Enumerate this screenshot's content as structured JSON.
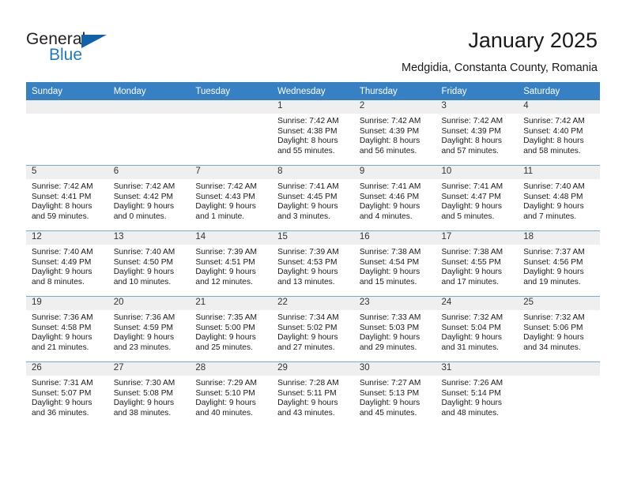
{
  "brand": {
    "name_part1": "General",
    "name_part2": "Blue"
  },
  "header": {
    "month_title": "January 2025",
    "location": "Medgidia, Constanta County, Romania"
  },
  "weekday_headers": [
    "Sunday",
    "Monday",
    "Tuesday",
    "Wednesday",
    "Thursday",
    "Friday",
    "Saturday"
  ],
  "colors": {
    "header_blue": "#3880c4",
    "brand_blue": "#1e7ac4",
    "logo_triangle_blue": "#1161ab",
    "daynum_bg": "#efefef",
    "grid_line": "#7ba7d0"
  },
  "weeks": [
    [
      {
        "empty": true
      },
      {
        "empty": true
      },
      {
        "empty": true
      },
      {
        "day": "1",
        "sunrise": "Sunrise: 7:42 AM",
        "sunset": "Sunset: 4:38 PM",
        "daylight1": "Daylight: 8 hours",
        "daylight2": "and 55 minutes."
      },
      {
        "day": "2",
        "sunrise": "Sunrise: 7:42 AM",
        "sunset": "Sunset: 4:39 PM",
        "daylight1": "Daylight: 8 hours",
        "daylight2": "and 56 minutes."
      },
      {
        "day": "3",
        "sunrise": "Sunrise: 7:42 AM",
        "sunset": "Sunset: 4:39 PM",
        "daylight1": "Daylight: 8 hours",
        "daylight2": "and 57 minutes."
      },
      {
        "day": "4",
        "sunrise": "Sunrise: 7:42 AM",
        "sunset": "Sunset: 4:40 PM",
        "daylight1": "Daylight: 8 hours",
        "daylight2": "and 58 minutes."
      }
    ],
    [
      {
        "day": "5",
        "sunrise": "Sunrise: 7:42 AM",
        "sunset": "Sunset: 4:41 PM",
        "daylight1": "Daylight: 8 hours",
        "daylight2": "and 59 minutes."
      },
      {
        "day": "6",
        "sunrise": "Sunrise: 7:42 AM",
        "sunset": "Sunset: 4:42 PM",
        "daylight1": "Daylight: 9 hours",
        "daylight2": "and 0 minutes."
      },
      {
        "day": "7",
        "sunrise": "Sunrise: 7:42 AM",
        "sunset": "Sunset: 4:43 PM",
        "daylight1": "Daylight: 9 hours",
        "daylight2": "and 1 minute."
      },
      {
        "day": "8",
        "sunrise": "Sunrise: 7:41 AM",
        "sunset": "Sunset: 4:45 PM",
        "daylight1": "Daylight: 9 hours",
        "daylight2": "and 3 minutes."
      },
      {
        "day": "9",
        "sunrise": "Sunrise: 7:41 AM",
        "sunset": "Sunset: 4:46 PM",
        "daylight1": "Daylight: 9 hours",
        "daylight2": "and 4 minutes."
      },
      {
        "day": "10",
        "sunrise": "Sunrise: 7:41 AM",
        "sunset": "Sunset: 4:47 PM",
        "daylight1": "Daylight: 9 hours",
        "daylight2": "and 5 minutes."
      },
      {
        "day": "11",
        "sunrise": "Sunrise: 7:40 AM",
        "sunset": "Sunset: 4:48 PM",
        "daylight1": "Daylight: 9 hours",
        "daylight2": "and 7 minutes."
      }
    ],
    [
      {
        "day": "12",
        "sunrise": "Sunrise: 7:40 AM",
        "sunset": "Sunset: 4:49 PM",
        "daylight1": "Daylight: 9 hours",
        "daylight2": "and 8 minutes."
      },
      {
        "day": "13",
        "sunrise": "Sunrise: 7:40 AM",
        "sunset": "Sunset: 4:50 PM",
        "daylight1": "Daylight: 9 hours",
        "daylight2": "and 10 minutes."
      },
      {
        "day": "14",
        "sunrise": "Sunrise: 7:39 AM",
        "sunset": "Sunset: 4:51 PM",
        "daylight1": "Daylight: 9 hours",
        "daylight2": "and 12 minutes."
      },
      {
        "day": "15",
        "sunrise": "Sunrise: 7:39 AM",
        "sunset": "Sunset: 4:53 PM",
        "daylight1": "Daylight: 9 hours",
        "daylight2": "and 13 minutes."
      },
      {
        "day": "16",
        "sunrise": "Sunrise: 7:38 AM",
        "sunset": "Sunset: 4:54 PM",
        "daylight1": "Daylight: 9 hours",
        "daylight2": "and 15 minutes."
      },
      {
        "day": "17",
        "sunrise": "Sunrise: 7:38 AM",
        "sunset": "Sunset: 4:55 PM",
        "daylight1": "Daylight: 9 hours",
        "daylight2": "and 17 minutes."
      },
      {
        "day": "18",
        "sunrise": "Sunrise: 7:37 AM",
        "sunset": "Sunset: 4:56 PM",
        "daylight1": "Daylight: 9 hours",
        "daylight2": "and 19 minutes."
      }
    ],
    [
      {
        "day": "19",
        "sunrise": "Sunrise: 7:36 AM",
        "sunset": "Sunset: 4:58 PM",
        "daylight1": "Daylight: 9 hours",
        "daylight2": "and 21 minutes."
      },
      {
        "day": "20",
        "sunrise": "Sunrise: 7:36 AM",
        "sunset": "Sunset: 4:59 PM",
        "daylight1": "Daylight: 9 hours",
        "daylight2": "and 23 minutes."
      },
      {
        "day": "21",
        "sunrise": "Sunrise: 7:35 AM",
        "sunset": "Sunset: 5:00 PM",
        "daylight1": "Daylight: 9 hours",
        "daylight2": "and 25 minutes."
      },
      {
        "day": "22",
        "sunrise": "Sunrise: 7:34 AM",
        "sunset": "Sunset: 5:02 PM",
        "daylight1": "Daylight: 9 hours",
        "daylight2": "and 27 minutes."
      },
      {
        "day": "23",
        "sunrise": "Sunrise: 7:33 AM",
        "sunset": "Sunset: 5:03 PM",
        "daylight1": "Daylight: 9 hours",
        "daylight2": "and 29 minutes."
      },
      {
        "day": "24",
        "sunrise": "Sunrise: 7:32 AM",
        "sunset": "Sunset: 5:04 PM",
        "daylight1": "Daylight: 9 hours",
        "daylight2": "and 31 minutes."
      },
      {
        "day": "25",
        "sunrise": "Sunrise: 7:32 AM",
        "sunset": "Sunset: 5:06 PM",
        "daylight1": "Daylight: 9 hours",
        "daylight2": "and 34 minutes."
      }
    ],
    [
      {
        "day": "26",
        "sunrise": "Sunrise: 7:31 AM",
        "sunset": "Sunset: 5:07 PM",
        "daylight1": "Daylight: 9 hours",
        "daylight2": "and 36 minutes."
      },
      {
        "day": "27",
        "sunrise": "Sunrise: 7:30 AM",
        "sunset": "Sunset: 5:08 PM",
        "daylight1": "Daylight: 9 hours",
        "daylight2": "and 38 minutes."
      },
      {
        "day": "28",
        "sunrise": "Sunrise: 7:29 AM",
        "sunset": "Sunset: 5:10 PM",
        "daylight1": "Daylight: 9 hours",
        "daylight2": "and 40 minutes."
      },
      {
        "day": "29",
        "sunrise": "Sunrise: 7:28 AM",
        "sunset": "Sunset: 5:11 PM",
        "daylight1": "Daylight: 9 hours",
        "daylight2": "and 43 minutes."
      },
      {
        "day": "30",
        "sunrise": "Sunrise: 7:27 AM",
        "sunset": "Sunset: 5:13 PM",
        "daylight1": "Daylight: 9 hours",
        "daylight2": "and 45 minutes."
      },
      {
        "day": "31",
        "sunrise": "Sunrise: 7:26 AM",
        "sunset": "Sunset: 5:14 PM",
        "daylight1": "Daylight: 9 hours",
        "daylight2": "and 48 minutes."
      },
      {
        "empty": true
      }
    ]
  ]
}
